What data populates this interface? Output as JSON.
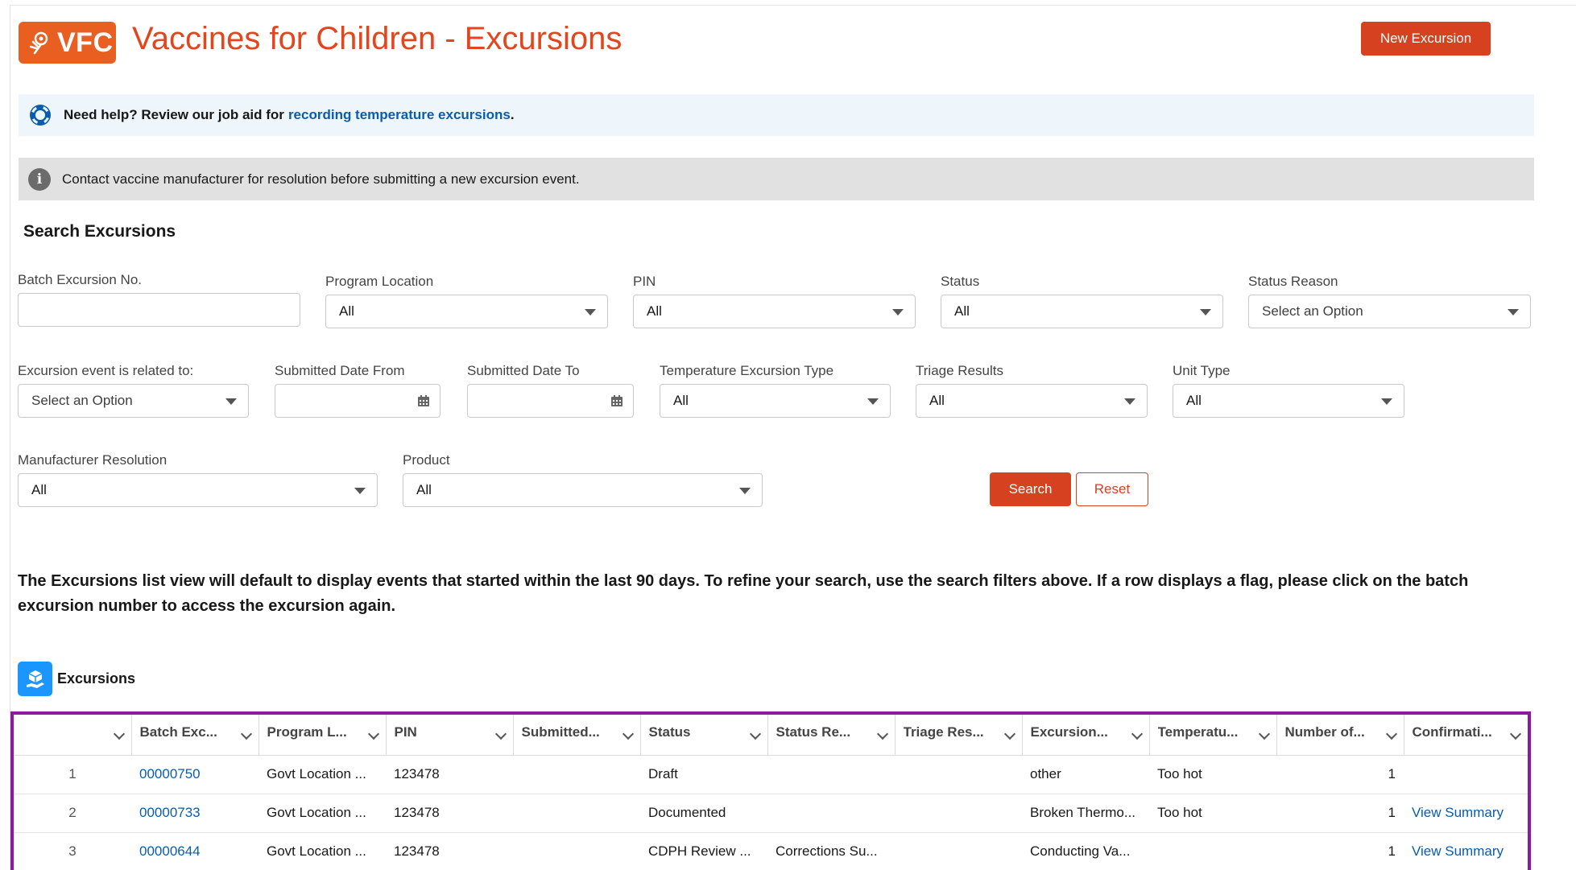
{
  "header": {
    "logo_text": "VFC",
    "title": "Vaccines for Children - Excursions",
    "new_button": "New Excursion"
  },
  "help_banner": {
    "prefix": "Need help? Review our job aid for",
    "link": "recording temperature excursions",
    "suffix": "."
  },
  "info_banner": {
    "text": "Contact vaccine manufacturer for resolution before submitting a new excursion event."
  },
  "search": {
    "title": "Search Excursions",
    "batch_no": {
      "label": "Batch Excursion No.",
      "value": ""
    },
    "program_location": {
      "label": "Program Location",
      "value": "All"
    },
    "pin": {
      "label": "PIN",
      "value": "All"
    },
    "status": {
      "label": "Status",
      "value": "All"
    },
    "status_reason": {
      "label": "Status Reason",
      "value": "Select an Option"
    },
    "related_to": {
      "label": "Excursion event is related to:",
      "value": "Select an Option"
    },
    "date_from": {
      "label": "Submitted Date From",
      "value": ""
    },
    "date_to": {
      "label": "Submitted Date To",
      "value": ""
    },
    "temp_type": {
      "label": "Temperature Excursion Type",
      "value": "All"
    },
    "triage": {
      "label": "Triage Results",
      "value": "All"
    },
    "unit_type": {
      "label": "Unit Type",
      "value": "All"
    },
    "manufacturer": {
      "label": "Manufacturer Resolution",
      "value": "All"
    },
    "product": {
      "label": "Product",
      "value": "All"
    },
    "search_button": "Search",
    "reset_button": "Reset"
  },
  "notice": "The Excursions list view will default to display events that started within the last 90 days. To refine your search, use the search filters above. If a row displays a flag, please click on the batch excursion number to access the excursion again.",
  "list": {
    "title": "Excursions",
    "columns": [
      "",
      "Batch Exc...",
      "Program L...",
      "PIN",
      "Submitted...",
      "Status",
      "Status Re...",
      "Triage Res...",
      "Excursion...",
      "Temperatu...",
      "Number of...",
      "Confirmati..."
    ],
    "rows": [
      {
        "n": "1",
        "batch": "00000750",
        "program": "Govt Location ...",
        "pin": "123478",
        "submitted": "",
        "status": "Draft",
        "status_reason": "",
        "triage": "",
        "excursion": "other",
        "temperature": "Too hot",
        "number": "1",
        "confirmation": ""
      },
      {
        "n": "2",
        "batch": "00000733",
        "program": "Govt Location ...",
        "pin": "123478",
        "submitted": "",
        "status": "Documented",
        "status_reason": "",
        "triage": "",
        "excursion": "Broken Thermo...",
        "temperature": "Too hot",
        "number": "1",
        "confirmation": "View Summary"
      },
      {
        "n": "3",
        "batch": "00000644",
        "program": "Govt Location ...",
        "pin": "123478",
        "submitted": "",
        "status": "CDPH Review ...",
        "status_reason": "Corrections Su...",
        "triage": "",
        "excursion": "Conducting Va...",
        "temperature": "",
        "number": "1",
        "confirmation": "View Summary"
      }
    ]
  },
  "colors": {
    "brand": "#e95f22",
    "title": "#e1461d",
    "button": "#d6411f",
    "link": "#0b5cab",
    "highlight": "#8b1a9e"
  }
}
